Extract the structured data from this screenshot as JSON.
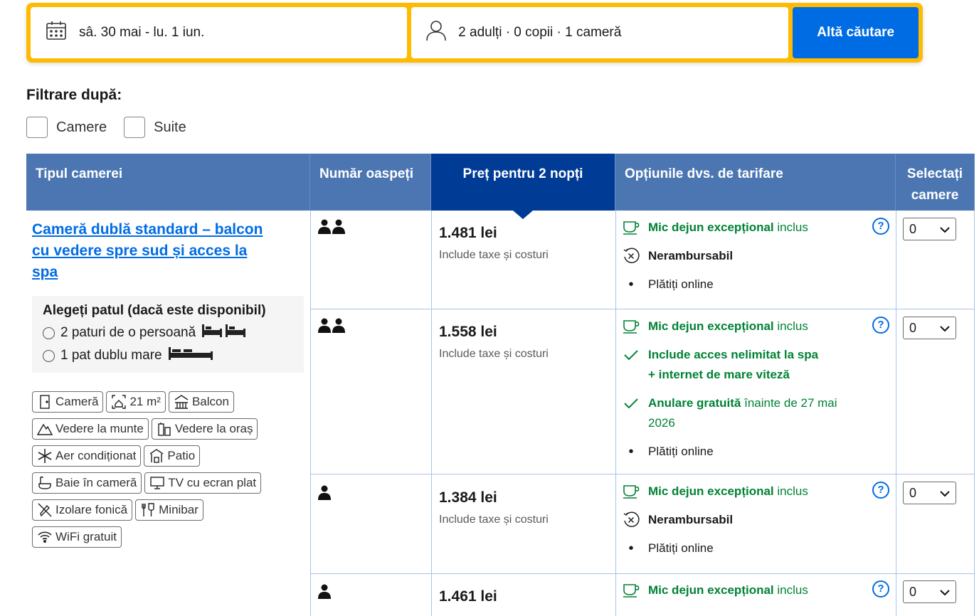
{
  "search": {
    "dates": "sâ. 30 mai - lu. 1 iun.",
    "guests": "2 adulți · 0 copii · 1 cameră",
    "button": "Altă căutare"
  },
  "filters": {
    "title": "Filtrare după:",
    "options": [
      "Camere",
      "Suite"
    ]
  },
  "table": {
    "headers": {
      "room_type": "Tipul camerei",
      "guests": "Număr oaspeți",
      "price": "Preț pentru 2 nopți",
      "options": "Opțiunile dvs. de tarifare",
      "select": "Selectați camere"
    },
    "room": {
      "name": "Cameră dublă standard – balcon cu vedere spre sud și acces la spa",
      "bed_title": "Alegeți patul (dacă este disponibil)",
      "beds": [
        "2 paturi de o persoană",
        "1 pat dublu mare"
      ],
      "facilities": [
        {
          "label": "Cameră",
          "icon": "door-icon"
        },
        {
          "label": "21 m²",
          "icon": "room-size-icon"
        },
        {
          "label": "Balcon",
          "icon": "balcony-icon"
        },
        {
          "label": "Vedere la munte",
          "icon": "mountain-icon"
        },
        {
          "label": "Vedere la oraș",
          "icon": "city-icon"
        },
        {
          "label": "Aer condiționat",
          "icon": "snowflake-icon"
        },
        {
          "label": "Patio",
          "icon": "patio-icon"
        },
        {
          "label": "Baie în cameră",
          "icon": "bath-icon"
        },
        {
          "label": "TV cu ecran plat",
          "icon": "tv-icon"
        },
        {
          "label": "Izolare fonică",
          "icon": "soundproof-icon"
        },
        {
          "label": "Minibar",
          "icon": "minibar-icon"
        },
        {
          "label": "WiFi gratuit",
          "icon": "wifi-icon"
        }
      ]
    },
    "rows": [
      {
        "price": "1.481 lei",
        "tax": "Include taxe și costuri",
        "select": "0",
        "breakfast_bold": "Mic dejun excepțional",
        "breakfast_rest": "inclus",
        "refund": "Nerambursabil",
        "pay": "Plătiți online"
      },
      {
        "price": "1.558 lei",
        "tax": "Include taxe și costuri",
        "select": "0",
        "breakfast_bold": "Mic dejun excepțional",
        "breakfast_rest": "inclus",
        "spa": "Include acces nelimitat la spa",
        "internet": "+ internet de mare viteză",
        "cancel_bold": "Anulare gratuită",
        "cancel_rest": "înainte de 27 mai 2026",
        "pay": "Plătiți online"
      },
      {
        "price": "1.384 lei",
        "tax": "Include taxe și costuri",
        "select": "0",
        "breakfast_bold": "Mic dejun excepțional",
        "breakfast_rest": "inclus",
        "refund": "Nerambursabil",
        "pay": "Plătiți online"
      },
      {
        "price": "1.461 lei",
        "select": "0",
        "breakfast_bold": "Mic dejun excepțional",
        "breakfast_rest": "inclus"
      }
    ],
    "help_glyph": "?"
  },
  "colors": {
    "accent_blue": "#006ce4",
    "header_blue": "#4b76b2",
    "selected_header": "#003b95",
    "search_yellow": "#febb02",
    "green": "#008234"
  }
}
